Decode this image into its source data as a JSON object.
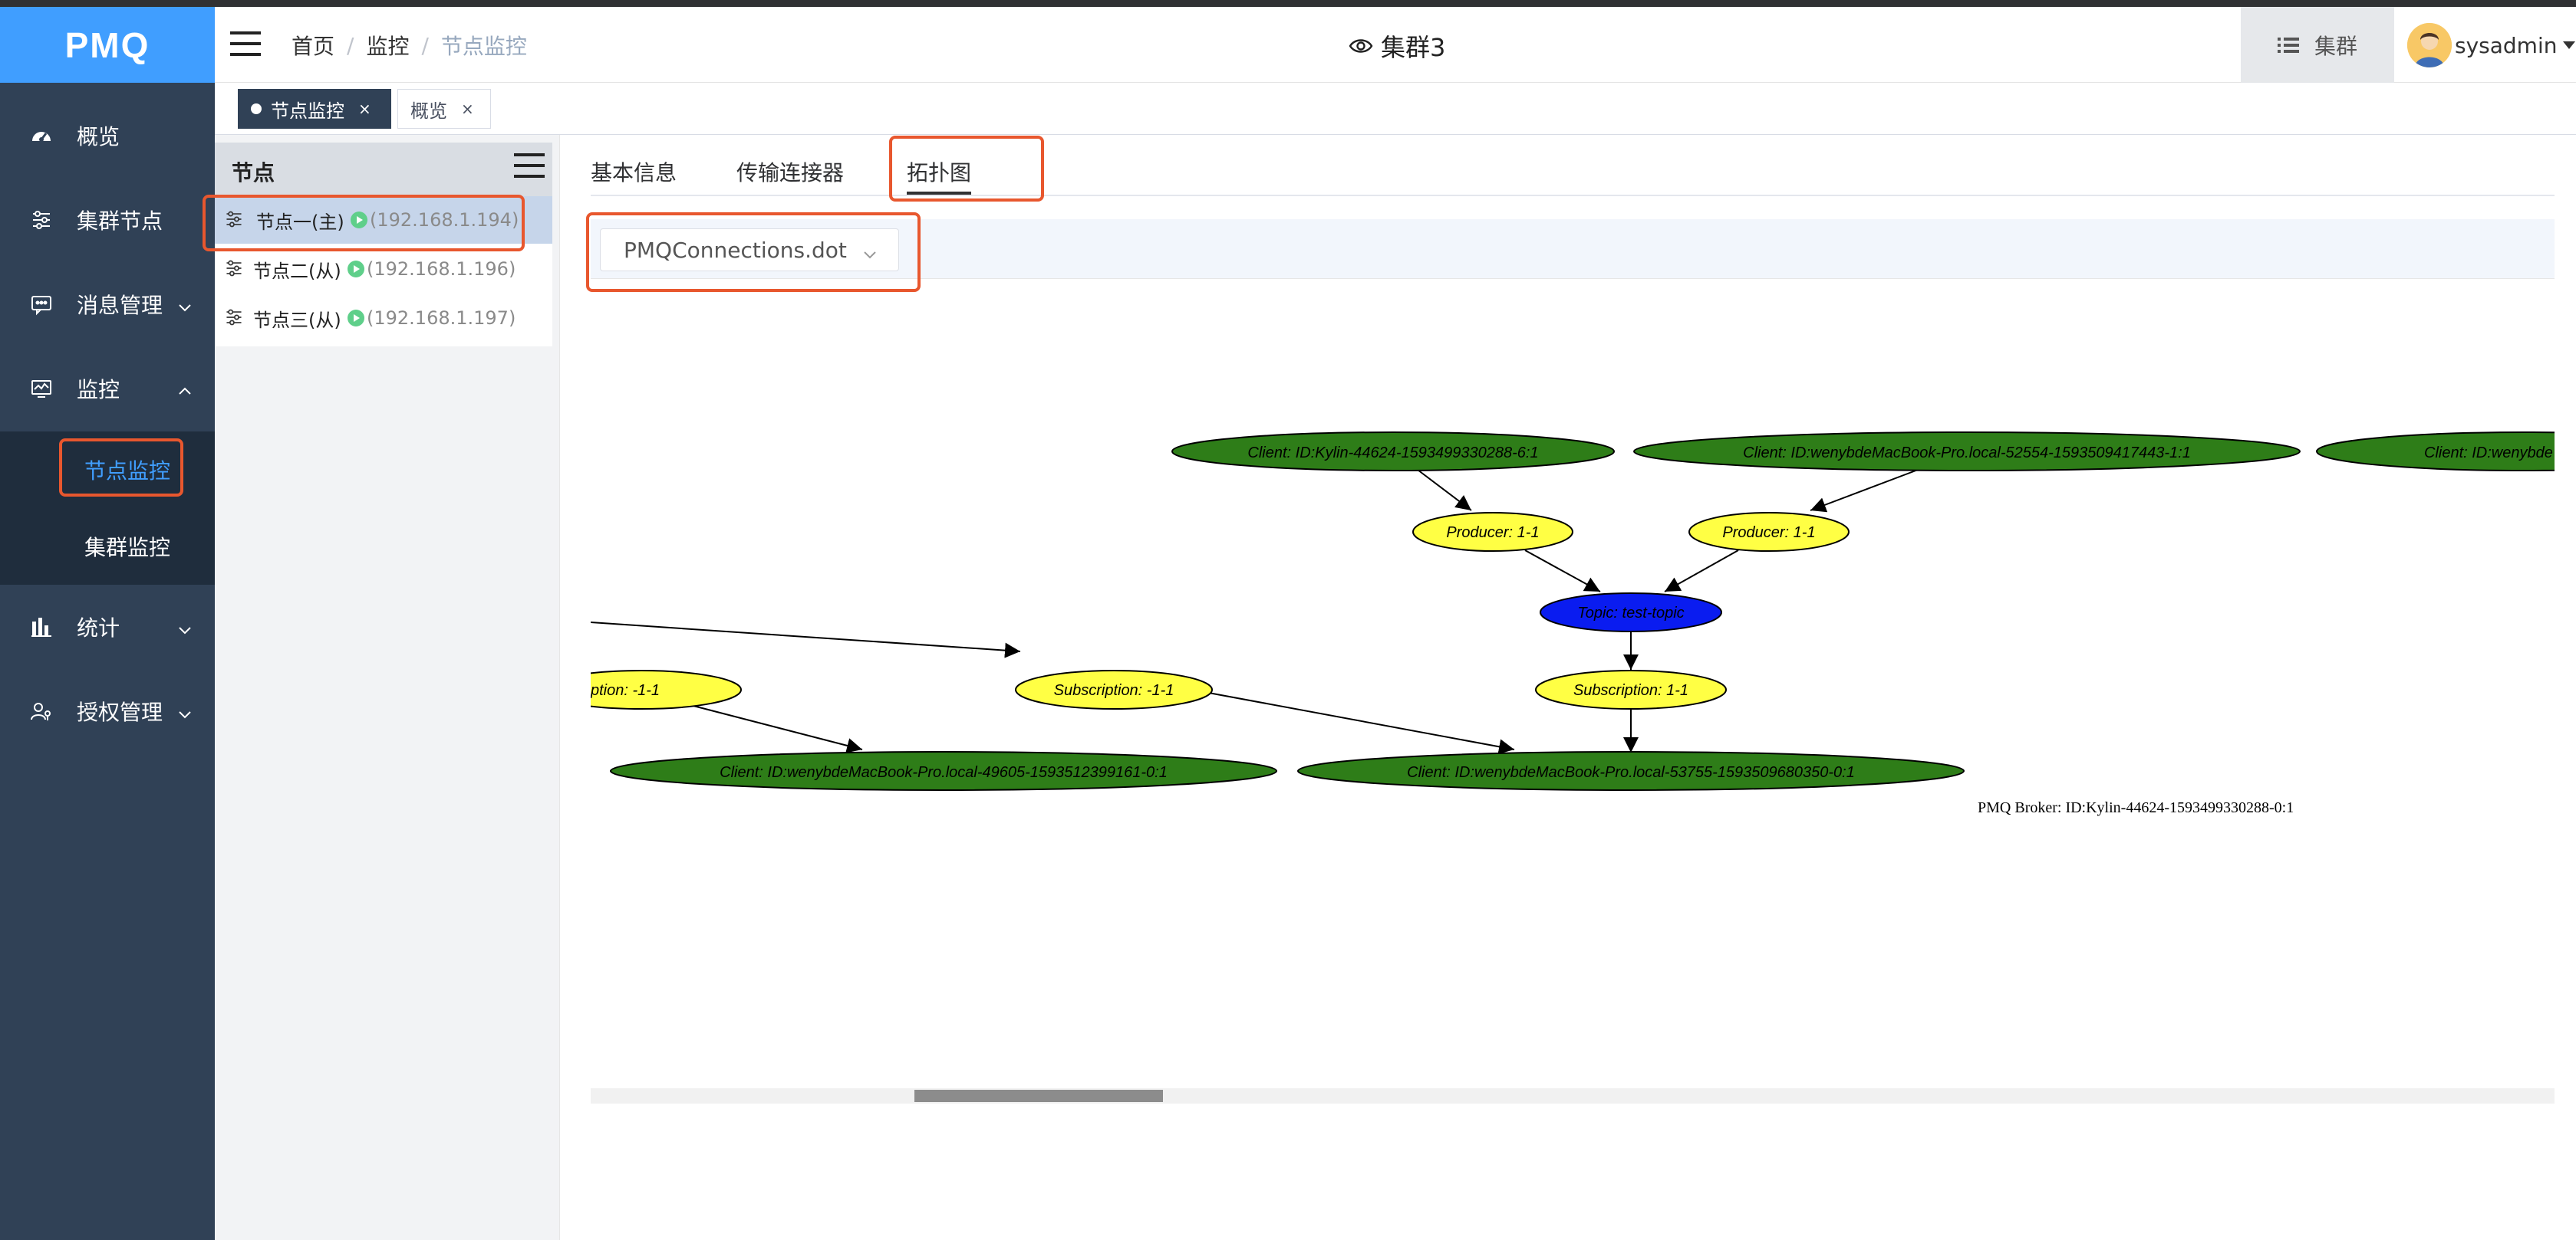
{
  "app": {
    "logo": "PMQ"
  },
  "colors": {
    "sidebar": "#304156",
    "logo_bg": "#409eff",
    "active": "#409eff",
    "highlight": "#e8572e"
  },
  "sidebar": {
    "items": [
      {
        "label": "概览",
        "icon": "dashboard-icon"
      },
      {
        "label": "集群节点",
        "icon": "sliders-icon"
      },
      {
        "label": "消息管理",
        "icon": "message-icon"
      },
      {
        "label": "监控",
        "icon": "monitor-icon"
      },
      {
        "label": "统计",
        "icon": "bar-chart-icon"
      },
      {
        "label": "授权管理",
        "icon": "user-key-icon"
      }
    ],
    "monitor_sub": [
      {
        "label": "节点监控"
      },
      {
        "label": "集群监控"
      }
    ]
  },
  "navbar": {
    "breadcrumb": [
      "首页",
      "监控",
      "节点监控"
    ],
    "cluster_title": "集群3",
    "cluster_button": "集群",
    "user": "sysadmin"
  },
  "tags": [
    {
      "label": "节点监控"
    },
    {
      "label": "概览"
    }
  ],
  "tree": {
    "title": "节点",
    "nodes": [
      {
        "name": "节点一(主)",
        "ip": "(192.168.1.194)"
      },
      {
        "name": "节点二(从)",
        "ip": "(192.168.1.196)"
      },
      {
        "name": "节点三(从)",
        "ip": "(192.168.1.197)"
      }
    ]
  },
  "tabs": [
    "基本信息",
    "传输连接器",
    "拓扑图"
  ],
  "select": {
    "value": "PMQConnections.dot"
  },
  "graph": {
    "client_top1": "Client: ID:Kylin-44624-1593499330288-6:1",
    "client_top2": "Client: ID:wenybdeMacBook-Pro.local-52554-1593509417443-1:1",
    "client_top3": "Client: ID:wenybde",
    "producer1": "Producer: 1-1",
    "producer2": "Producer: 1-1",
    "topic": "Topic: test-topic",
    "subscription_left": "ption: -1-1",
    "subscription_mid": "Subscription: -1-1",
    "subscription_right": "Subscription: 1-1",
    "client_bottom1": "Client: ID:wenybdeMacBook-Pro.local-49605-1593512399161-0:1",
    "client_bottom2": "Client: ID:wenybdeMacBook-Pro.local-53755-1593509680350-0:1",
    "broker": "PMQ Broker: ID:Kylin-44624-1593499330288-0:1"
  }
}
